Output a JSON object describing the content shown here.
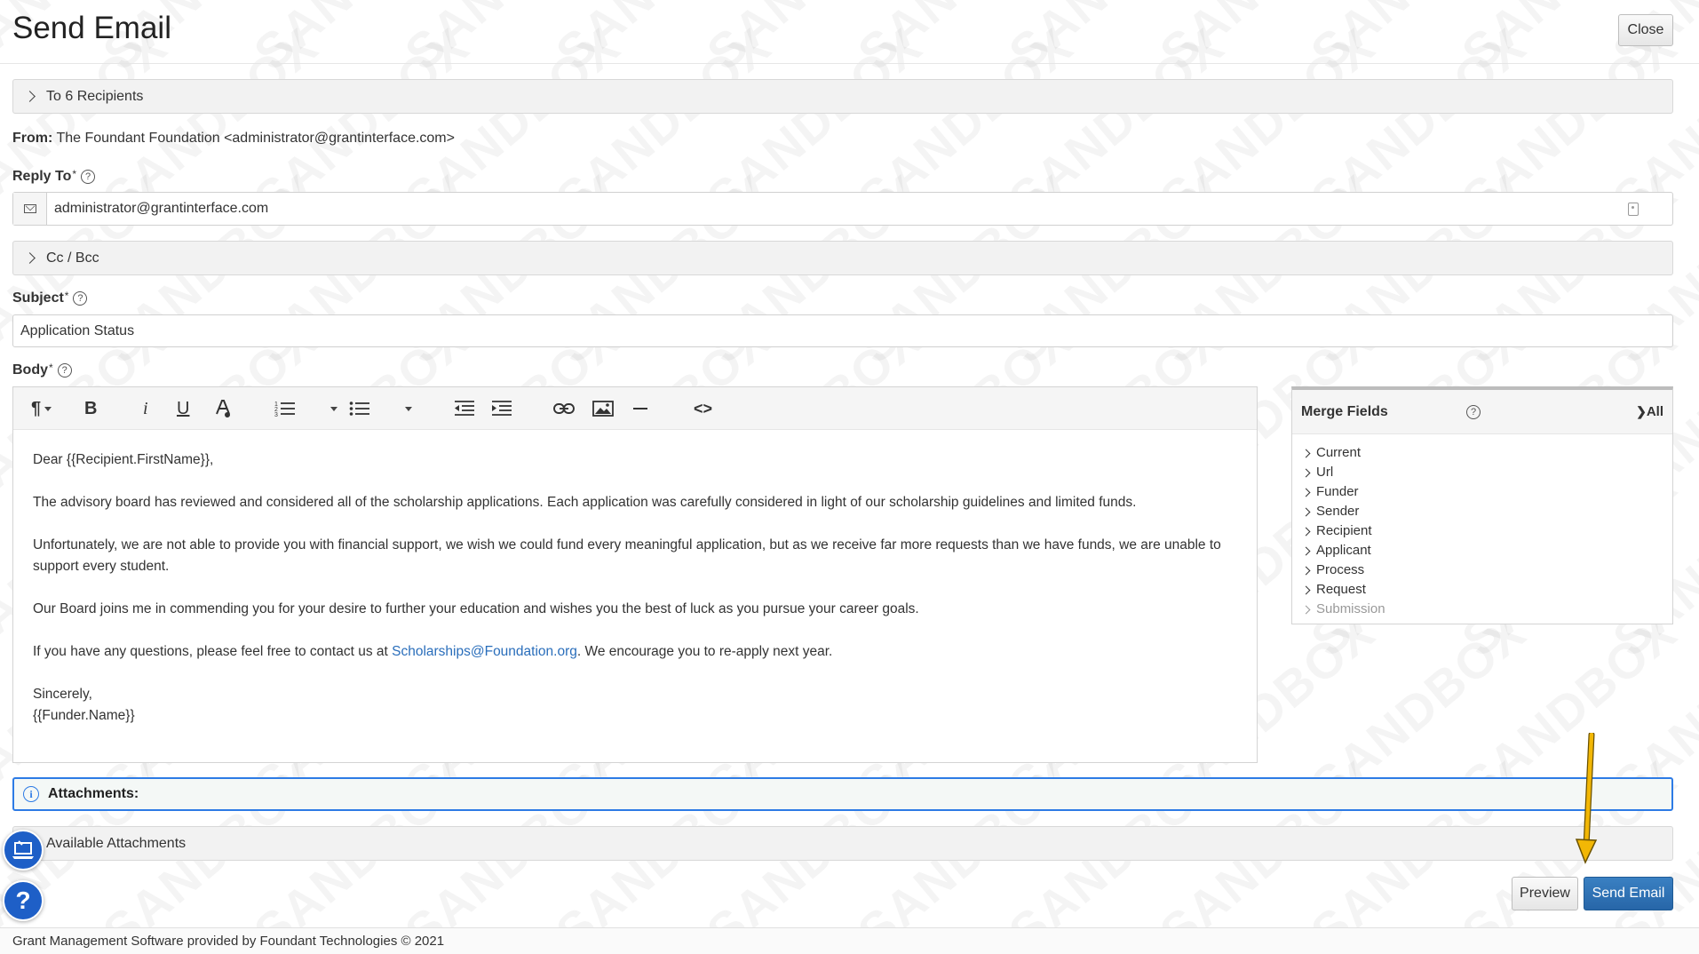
{
  "header": {
    "title": "Send Email",
    "close_label": "Close"
  },
  "recipients": {
    "label": "To 6 Recipients"
  },
  "from": {
    "label": "From:",
    "value": "The Foundant Foundation <administrator@grantinterface.com>"
  },
  "reply_to": {
    "label": "Reply To",
    "required": "*",
    "value": "administrator@grantinterface.com"
  },
  "cc_bcc": {
    "label": "Cc / Bcc"
  },
  "subject": {
    "label": "Subject",
    "required": "*",
    "value": "Application Status"
  },
  "body": {
    "label": "Body",
    "required": "*",
    "greeting": "Dear {{Recipient.FirstName}},",
    "p1": "The advisory board has reviewed and considered all of the scholarship applications. Each application was carefully considered in light of our scholarship guidelines and limited funds.",
    "p2": "Unfortunately, we are not able to provide you with financial support, we wish we could fund every meaningful application, but as we receive far more requests than we have funds, we are unable to support every student.",
    "p3": "Our Board joins me in commending you for your desire to further your education and wishes you the best of luck as you pursue your career goals.",
    "p4_before": "If you have any questions, please feel free to contact us at ",
    "p4_link": "Scholarships@Foundation.org",
    "p4_after": ". We encourage you to re-apply next year.",
    "closing": "Sincerely,",
    "signature": "{{Funder.Name}}"
  },
  "toolbar": {
    "paragraph": "¶",
    "bold": "B",
    "italic": "i",
    "underline": "U",
    "color": "A",
    "code": "<>"
  },
  "merge_fields": {
    "title": "Merge Fields",
    "all_label": "All",
    "items": [
      "Current",
      "Url",
      "Funder",
      "Sender",
      "Recipient",
      "Applicant",
      "Process",
      "Request",
      "Submission"
    ]
  },
  "attachments": {
    "label": "Attachments:",
    "available_label": "Available Attachments"
  },
  "actions": {
    "preview_label": "Preview",
    "send_label": "Send Email"
  },
  "help_fab": "?",
  "footer": {
    "text": "Grant Management Software provided by Foundant Technologies © 2021"
  },
  "watermark": "SANDBOX",
  "colors": {
    "primary": "#2766a8",
    "attachment_border": "#2d7be5",
    "arrow": "#f2b705",
    "link": "#2a6ebb"
  }
}
